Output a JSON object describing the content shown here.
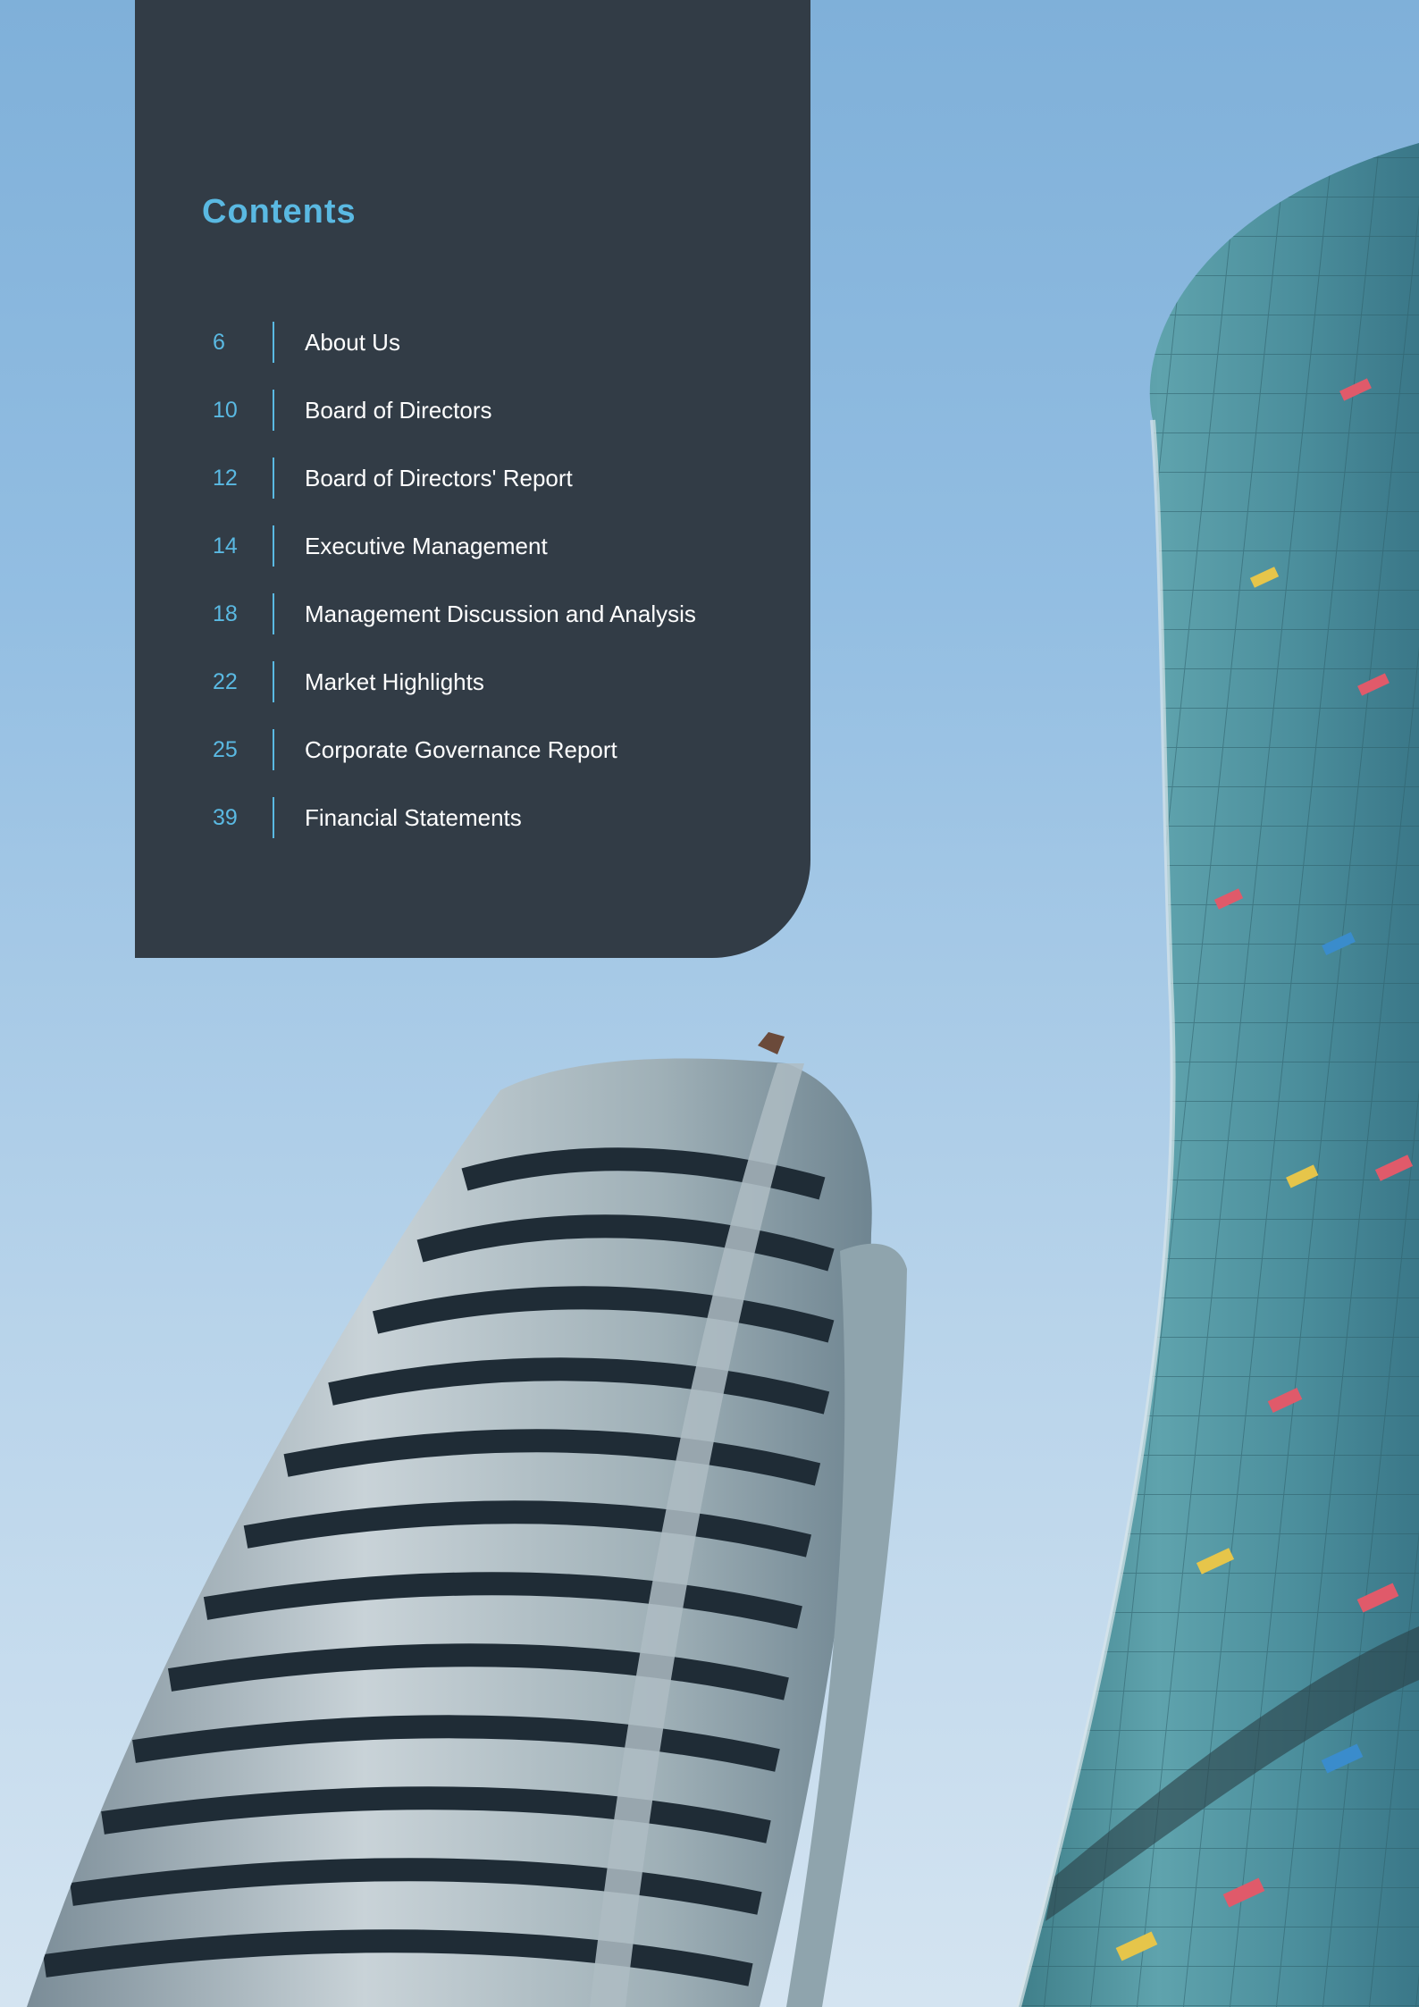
{
  "contents": {
    "title": "Contents",
    "items": [
      {
        "page": "6",
        "label": "About Us"
      },
      {
        "page": "10",
        "label": "Board of Directors"
      },
      {
        "page": "12",
        "label": "Board of Directors' Report"
      },
      {
        "page": "14",
        "label": "Executive Management"
      },
      {
        "page": "18",
        "label": "Management Discussion and Analysis"
      },
      {
        "page": "22",
        "label": "Market Highlights"
      },
      {
        "page": "25",
        "label": "Corporate Governance Report"
      },
      {
        "page": "39",
        "label": "Financial Statements"
      }
    ]
  },
  "colors": {
    "panel": "#323c46",
    "accent": "#5ab9e2",
    "text": "#ffffff",
    "sky_top": "#7fb0d9",
    "sky_bottom": "#d4e4f1"
  }
}
